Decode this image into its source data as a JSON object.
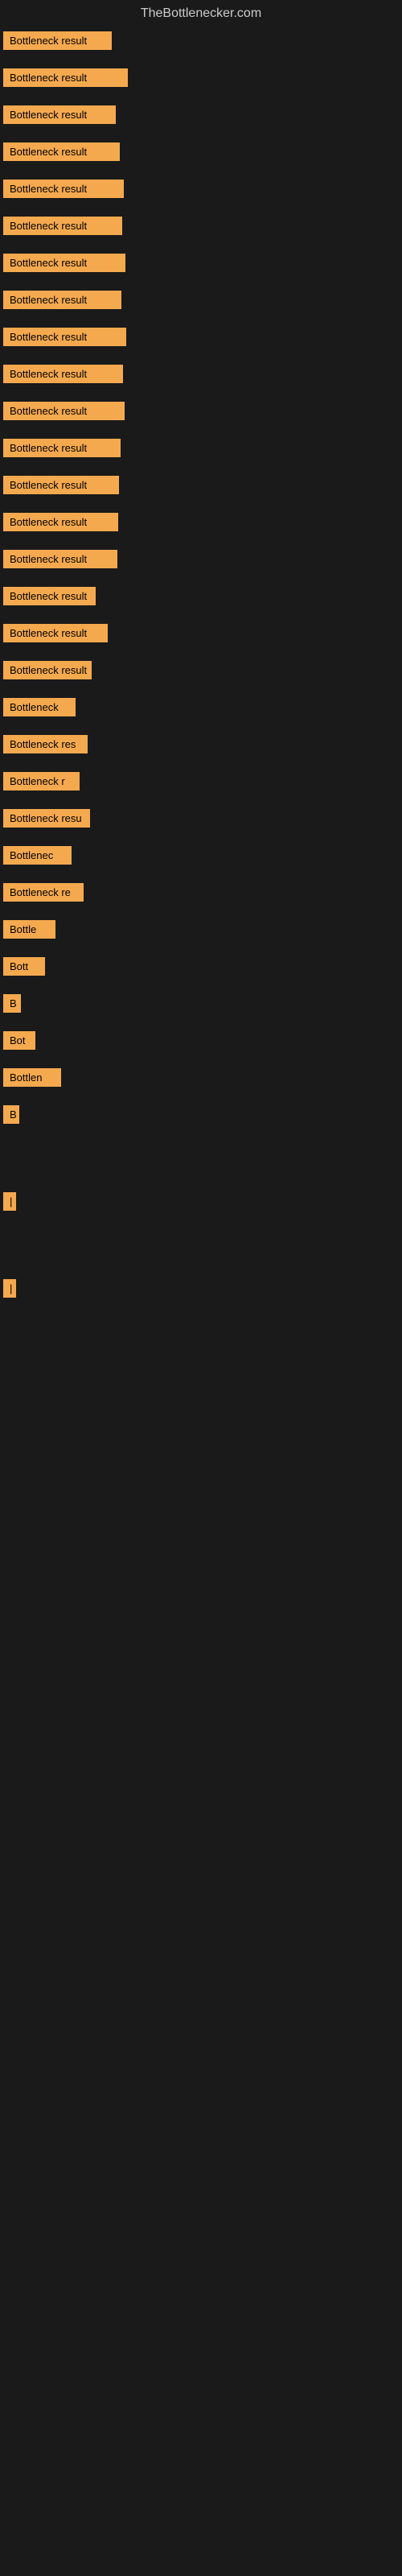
{
  "site": {
    "title": "TheBottlenecker.com"
  },
  "bars": [
    {
      "label": "Bottleneck result",
      "width": 135,
      "margin_bottom": 18
    },
    {
      "label": "Bottleneck result",
      "width": 155,
      "margin_bottom": 18
    },
    {
      "label": "Bottleneck result",
      "width": 140,
      "margin_bottom": 18
    },
    {
      "label": "Bottleneck result",
      "width": 145,
      "margin_bottom": 18
    },
    {
      "label": "Bottleneck result",
      "width": 150,
      "margin_bottom": 18
    },
    {
      "label": "Bottleneck result",
      "width": 148,
      "margin_bottom": 18
    },
    {
      "label": "Bottleneck result",
      "width": 152,
      "margin_bottom": 18
    },
    {
      "label": "Bottleneck result",
      "width": 147,
      "margin_bottom": 18
    },
    {
      "label": "Bottleneck result",
      "width": 153,
      "margin_bottom": 18
    },
    {
      "label": "Bottleneck result",
      "width": 149,
      "margin_bottom": 18
    },
    {
      "label": "Bottleneck result",
      "width": 151,
      "margin_bottom": 18
    },
    {
      "label": "Bottleneck result",
      "width": 146,
      "margin_bottom": 18
    },
    {
      "label": "Bottleneck result",
      "width": 144,
      "margin_bottom": 18
    },
    {
      "label": "Bottleneck result",
      "width": 143,
      "margin_bottom": 18
    },
    {
      "label": "Bottleneck result",
      "width": 142,
      "margin_bottom": 18
    },
    {
      "label": "Bottleneck result",
      "width": 115,
      "margin_bottom": 18
    },
    {
      "label": "Bottleneck result",
      "width": 130,
      "margin_bottom": 18
    },
    {
      "label": "Bottleneck result",
      "width": 110,
      "margin_bottom": 18
    },
    {
      "label": "Bottleneck",
      "width": 90,
      "margin_bottom": 18
    },
    {
      "label": "Bottleneck res",
      "width": 105,
      "margin_bottom": 18
    },
    {
      "label": "Bottleneck r",
      "width": 95,
      "margin_bottom": 18
    },
    {
      "label": "Bottleneck resu",
      "width": 108,
      "margin_bottom": 18
    },
    {
      "label": "Bottlenec",
      "width": 85,
      "margin_bottom": 18
    },
    {
      "label": "Bottleneck re",
      "width": 100,
      "margin_bottom": 18
    },
    {
      "label": "Bottle",
      "width": 65,
      "margin_bottom": 18
    },
    {
      "label": "Bott",
      "width": 52,
      "margin_bottom": 18
    },
    {
      "label": "B",
      "width": 22,
      "margin_bottom": 18
    },
    {
      "label": "Bot",
      "width": 40,
      "margin_bottom": 18
    },
    {
      "label": "Bottlen",
      "width": 72,
      "margin_bottom": 18
    },
    {
      "label": "B",
      "width": 20,
      "margin_bottom": 18
    },
    {
      "label": "",
      "width": 0,
      "margin_bottom": 80
    },
    {
      "label": "|",
      "width": 12,
      "margin_bottom": 80
    },
    {
      "label": "",
      "width": 0,
      "margin_bottom": 80
    },
    {
      "label": "",
      "width": 0,
      "margin_bottom": 60
    },
    {
      "label": "",
      "width": 0,
      "margin_bottom": 40
    },
    {
      "label": "|",
      "width": 12,
      "margin_bottom": 40
    }
  ]
}
